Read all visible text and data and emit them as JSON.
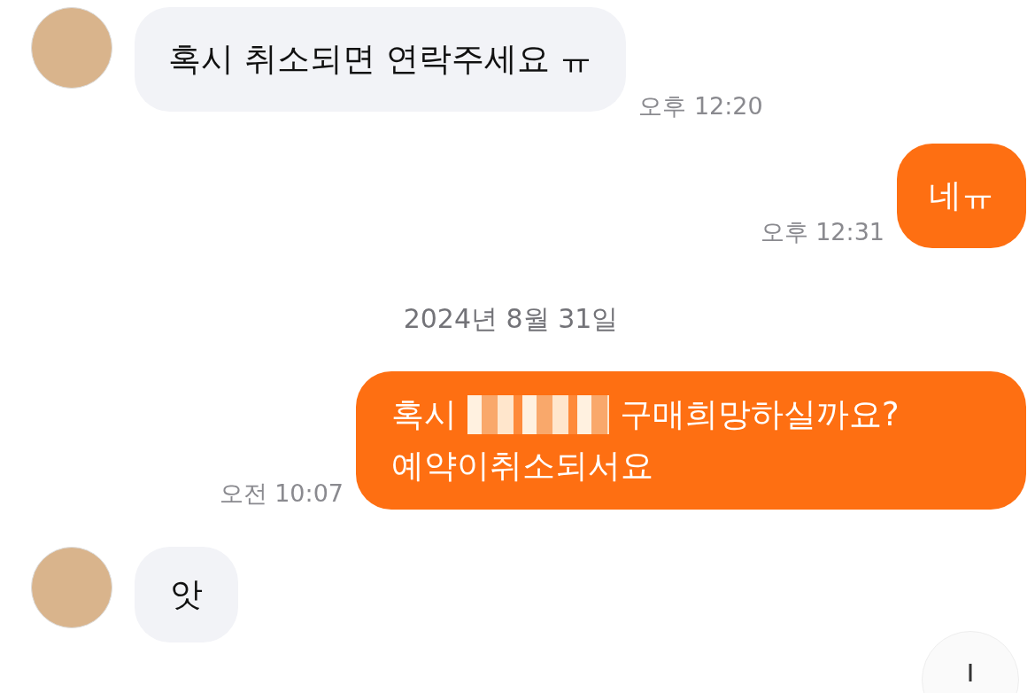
{
  "messages": [
    {
      "kind": "incoming",
      "segments": [
        {
          "kind": "text",
          "text": "혹시 취소되면 연락주세요 ㅠ"
        }
      ],
      "time": "오후 12:20"
    },
    {
      "kind": "outgoing",
      "segments": [
        {
          "kind": "text",
          "text": "네ㅠ"
        }
      ],
      "time": "오후 12:31"
    },
    {
      "kind": "date",
      "text": "2024년 8월 31일"
    },
    {
      "kind": "outgoing",
      "segments": [
        {
          "kind": "text",
          "text": "혹시"
        },
        {
          "kind": "redacted"
        },
        {
          "kind": "text",
          "text": "구매희망하실까요?"
        },
        {
          "kind": "break"
        },
        {
          "kind": "text",
          "text": "예약이취소되서요"
        }
      ],
      "time": "오전 10:07"
    },
    {
      "kind": "incoming",
      "segments": [
        {
          "kind": "text",
          "text": "앗"
        }
      ]
    }
  ]
}
